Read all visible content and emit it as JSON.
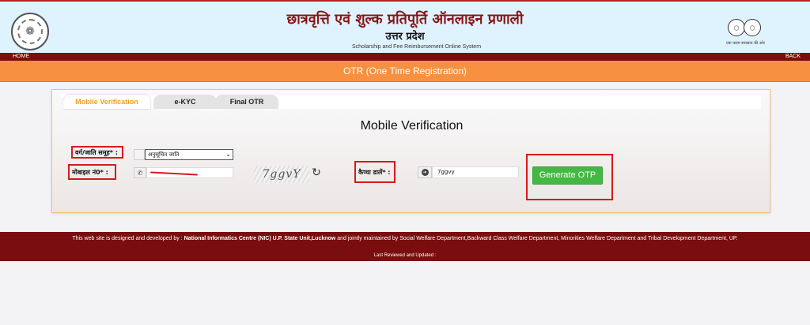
{
  "header": {
    "title_hi": "छात्रवृत्ति एवं शुल्क प्रतिपूर्ति ऑनलाइन प्रणाली",
    "state_hi": "उत्तर प्रदेश",
    "subtitle_en": "Scholarship and Fee Reimbursement Online System",
    "right_logo_caption": "एक कदम स्वच्छता की ओर"
  },
  "nav": {
    "home": "HOME",
    "back": "BACK"
  },
  "banner": {
    "title": "OTR (One Time Registration)"
  },
  "tabs": [
    {
      "label": "Mobile Verification",
      "active": true
    },
    {
      "label": "e-KYC",
      "active": false
    },
    {
      "label": "Final OTR",
      "active": false
    }
  ],
  "form": {
    "section_title": "Mobile Verification",
    "caste_label": "वर्ग/जाति समूह* :",
    "caste_selected": "अनुसूचित जाति",
    "mobile_label": "मोबाइल नं0* :",
    "mobile_value": "",
    "captcha_image_text": "7ggvY",
    "captcha_label": "कैप्चा डालें* :",
    "captcha_value": "7ggvy",
    "generate_button": "Generate OTP"
  },
  "footer": {
    "line1_prefix": "This web site is designed and developed by : ",
    "line1_org": "National Informatics Centre (NIC) U.P. State Unit,Lucknow",
    "line1_suffix": " and jointly maintained by Social Welfare Department,Backward Class Welfare Department, Minorities Welfare Department and Tribal Development Department, UP.",
    "line3": "Last Reviewed and Updated :"
  },
  "colors": {
    "header_bg": "#dff3ff",
    "maroon": "#7a0d0d",
    "orange": "#f7913f",
    "button_green": "#44b844",
    "highlight_red": "#d61a1a",
    "tab_active": "#f0a020"
  }
}
